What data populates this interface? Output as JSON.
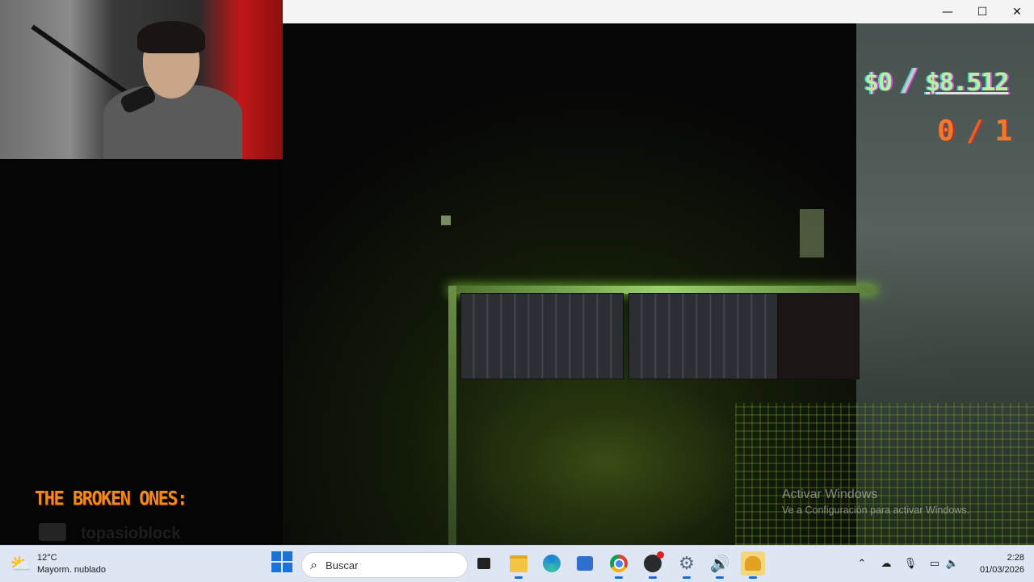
{
  "window": {
    "controls": {
      "minimize": "—",
      "maximize": "☐",
      "close": "✕"
    }
  },
  "hud": {
    "money_current": "$0",
    "money_target": "$8.512",
    "loot_current": "0",
    "loot_total": "1",
    "colors": {
      "money": "#b9f0a0",
      "loot": "#f07a2a"
    }
  },
  "activation_watermark": {
    "title": "Activar Windows",
    "subtitle": "Ve a Configuración para activar Windows."
  },
  "overlay": {
    "broken_ones_title": "THE BROKEN ONES:",
    "broken_ones_name": "topasioblock"
  },
  "taskbar": {
    "weather": {
      "icon": "partly-cloudy-icon",
      "temperature": "12°C",
      "condition": "Mayorm. nublado"
    },
    "search_placeholder": "Buscar",
    "apps": [
      {
        "name": "task-view",
        "icon": "task-view-icon"
      },
      {
        "name": "file-explorer",
        "icon": "folder-icon"
      },
      {
        "name": "edge",
        "icon": "edge-icon"
      },
      {
        "name": "store",
        "icon": "store-icon"
      },
      {
        "name": "chrome",
        "icon": "chrome-icon"
      },
      {
        "name": "obs",
        "icon": "obs-icon"
      },
      {
        "name": "settings",
        "icon": "gear-icon"
      },
      {
        "name": "audio",
        "icon": "speaker-app-icon"
      },
      {
        "name": "game",
        "icon": "game-icon"
      }
    ],
    "clock": {
      "time": "2:28",
      "date": "01/03/2026"
    }
  }
}
